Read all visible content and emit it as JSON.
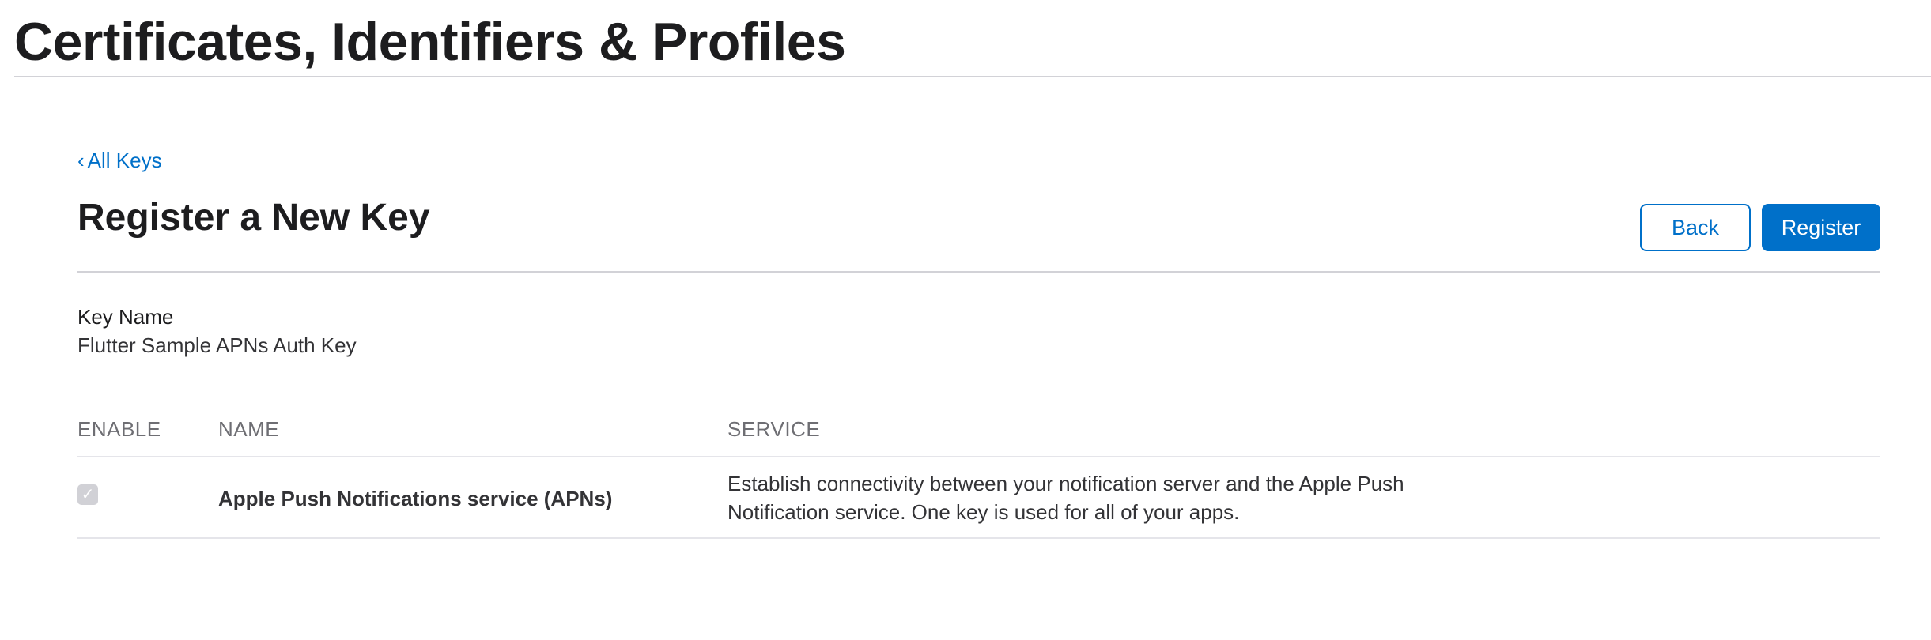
{
  "header": {
    "title": "Certificates, Identifiers & Profiles"
  },
  "nav": {
    "back_link_chevron": "‹",
    "back_link_label": "All Keys"
  },
  "form": {
    "title": "Register a New Key",
    "back_button_label": "Back",
    "register_button_label": "Register",
    "key_name_label": "Key Name",
    "key_name_value": "Flutter Sample APNs Auth Key"
  },
  "services_table": {
    "columns": [
      "ENABLE",
      "NAME",
      "SERVICE"
    ],
    "rows": [
      {
        "enabled": true,
        "checkbox_disabled": true,
        "name": "Apple Push Notifications service (APNs)",
        "service": "Establish connectivity between your notification server and the Apple Push Notification service. One key is used for all of your apps."
      }
    ]
  },
  "colors": {
    "accent": "#0070c9",
    "text": "#1d1d1f",
    "muted": "#6e6e73",
    "divider": "#d2d2d7",
    "checkbox_disabled": "#d1d1d6"
  }
}
